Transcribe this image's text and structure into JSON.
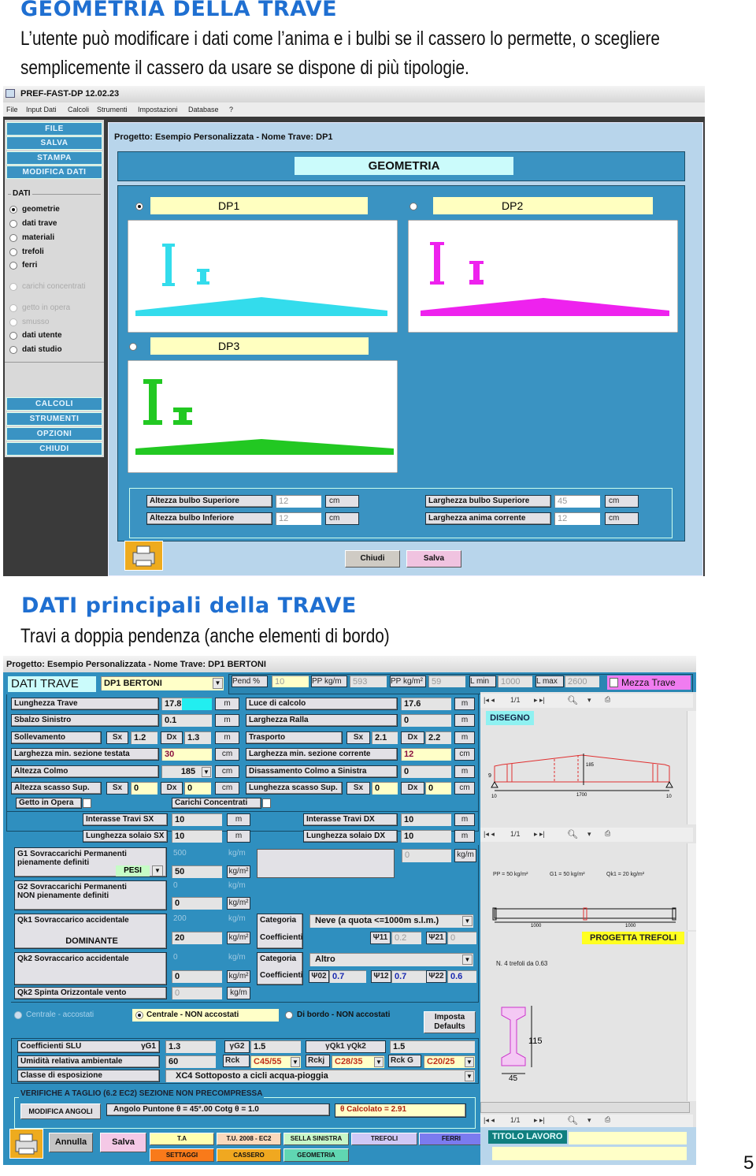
{
  "section1": {
    "heading": "GEOMETRIA DELLA TRAVE",
    "text_line1": "L’utente può modificare i dati come l’anima e i bulbi se il cassero lo permette, o scegliere",
    "text_line2": "semplicemente il cassero da usare se dispone di più tipologie."
  },
  "app1": {
    "window_title": "PREF-FAST-DP 12.02.23",
    "menu": [
      "File",
      "Input Dati",
      "Calcoli",
      "Strumenti",
      "Impostazioni",
      "Database",
      "?"
    ],
    "sidebar_top_buttons": [
      "FILE",
      "SALVA",
      "STAMPA",
      "MODIFICA DATI"
    ],
    "dati_group_label": "DATI",
    "dati_options": [
      {
        "label": "geometrie",
        "selected": true,
        "enabled": true
      },
      {
        "label": "dati trave",
        "selected": false,
        "enabled": true
      },
      {
        "label": "materiali",
        "selected": false,
        "enabled": true
      },
      {
        "label": "trefoli",
        "selected": false,
        "enabled": true
      },
      {
        "label": "ferri",
        "selected": false,
        "enabled": true
      },
      {
        "label": "carichi concentrati",
        "selected": false,
        "enabled": false
      },
      {
        "label": "getto in opera",
        "selected": false,
        "enabled": false
      },
      {
        "label": "smusso",
        "selected": false,
        "enabled": false
      },
      {
        "label": "dati utente",
        "selected": false,
        "enabled": true
      },
      {
        "label": "dati studio",
        "selected": false,
        "enabled": true
      }
    ],
    "sidebar_bottom_buttons": [
      "CALCOLI",
      "STRUMENTI",
      "OPZIONI",
      "CHIUDI"
    ],
    "project_title": "Progetto: Esempio Personalizzata - Nome Trave: DP1",
    "panel_title": "GEOMETRIA",
    "options": [
      {
        "label": "DP1",
        "selected": true,
        "color": "#33dcec"
      },
      {
        "label": "DP2",
        "selected": false,
        "color": "#ee22ee"
      },
      {
        "label": "DP3",
        "selected": false,
        "color": "#22c822"
      }
    ],
    "fields": [
      {
        "label": "Altezza bulbo Superiore",
        "value": "12",
        "unit": "cm"
      },
      {
        "label": "Altezza bulbo Inferiore",
        "value": "12",
        "unit": "cm"
      },
      {
        "label": "Larghezza bulbo Superiore",
        "value": "45",
        "unit": "cm"
      },
      {
        "label": "Larghezza anima corrente",
        "value": "12",
        "unit": "cm"
      }
    ],
    "buttons": {
      "close": "Chiudi",
      "save": "Salva"
    }
  },
  "section2": {
    "heading": "DATI principali della TRAVE",
    "text_line1": "Travi a doppia pendenza (anche elementi di bordo)"
  },
  "app2": {
    "project_title": "Progetto: Esempio Personalizzata - Nome Trave: DP1 BERTONI",
    "header": {
      "title": "DATI TRAVE",
      "trave_select": "DP1 BERTONI",
      "pend_label": "Pend %",
      "pend_value": "10",
      "pp_m_label": "PP kg/m",
      "pp_m_value": "593",
      "pp_m2_label": "PP kg/m²",
      "pp_m2_value": "59",
      "lmin_label": "L min",
      "lmin_value": "1000",
      "lmax_label": "L max",
      "lmax_value": "2600",
      "mezza_trave": "Mezza Trave",
      "mezza_trave_checked": false
    },
    "left_rows": [
      {
        "label": "Lunghezza Trave",
        "value": "17.8",
        "unit": "m"
      },
      {
        "label": "Sbalzo Sinistro",
        "value": "0.1",
        "unit": "m"
      },
      {
        "label": "Sollevamento",
        "sx_label": "Sx",
        "sx": "1.2",
        "dx_label": "Dx",
        "dx": "1.3",
        "unit": "m"
      },
      {
        "label": "Larghezza min. sezione testata",
        "value": "30",
        "unit": "cm"
      },
      {
        "label": "Altezza Colmo",
        "value": "185",
        "unit": "cm"
      },
      {
        "label": "Altezza scasso Sup.",
        "sx_label": "Sx",
        "sx": "0",
        "dx_label": "Dx",
        "dx": "0",
        "unit": "cm"
      }
    ],
    "right_rows": [
      {
        "label": "Luce di calcolo",
        "value": "17.6",
        "unit": "m"
      },
      {
        "label": "Larghezza Ralla",
        "value": "0",
        "unit": "m"
      },
      {
        "label": "Trasporto",
        "sx_label": "Sx",
        "sx": "2.1",
        "dx_label": "Dx",
        "dx": "2.2",
        "unit": "m"
      },
      {
        "label": "Larghezza min. sezione corrente",
        "value": "12",
        "unit": "cm"
      },
      {
        "label": "Disassamento Colmo a Sinistra",
        "value": "0",
        "unit": "m"
      },
      {
        "label": "Lunghezza scasso Sup.",
        "sx_label": "Sx",
        "sx": "0",
        "dx_label": "Dx",
        "dx": "0",
        "unit": "cm"
      }
    ],
    "getto_in_opera": "Getto in Opera",
    "carichi_concentrati": "Carichi Concentrati",
    "interassi": [
      {
        "label": "Interasse Travi SX",
        "value": "10",
        "unit": "m"
      },
      {
        "label": "Lunghezza solaio SX",
        "value": "10",
        "unit": "m"
      },
      {
        "label": "Interasse Travi DX",
        "value": "10",
        "unit": "m"
      },
      {
        "label": "Lunghezza solaio DX",
        "value": "10",
        "unit": "m"
      }
    ],
    "loads": {
      "g1": {
        "line1": "G1   Sovraccarichi Permanenti",
        "line2": "pienamente definiti",
        "pesi": "PESI",
        "kgm": "500",
        "kgm_unit": "kg/m",
        "value": "50",
        "unit": "kg/m²",
        "extra_value": "0",
        "extra_unit": "kg/m"
      },
      "g2": {
        "line1": "G2   Sovraccarichi Permanenti",
        "line2": "NON pienamente definiti",
        "kgm": "0",
        "kgm_unit": "kg/m",
        "value": "0",
        "unit": "kg/m²"
      },
      "qk1": {
        "line1": "Qk1  Sovraccarico accidentale",
        "line2": "DOMINANTE",
        "kgm": "200",
        "kgm_unit": "kg/m",
        "value": "20",
        "unit": "kg/m²",
        "categoria_label": "Categoria",
        "coeff_label": "Coefficienti",
        "categoria": "Neve (a quota <=1000m s.l.m.)",
        "psi11_label": "Ψ11",
        "psi11": "0.2",
        "psi21_label": "Ψ21",
        "psi21": "0"
      },
      "qk2": {
        "line1": "Qk2  Sovraccarico accidentale",
        "kgm": "0",
        "kgm_unit": "kg/m",
        "value": "0",
        "unit": "kg/m²",
        "categoria_label": "Categoria",
        "coeff_label": "Coefficienti",
        "categoria": "Altro",
        "psi02_label": "Ψ02",
        "psi02": "0.7",
        "psi12_label": "Ψ12",
        "psi12": "0.7",
        "psi22_label": "Ψ22",
        "psi22": "0.6"
      },
      "vento": {
        "label": "Qk2  Spinta Orizzontale vento",
        "value": "0",
        "unit": "kg/m"
      }
    },
    "position_options": [
      {
        "label": "Centrale - accostati",
        "selected": false,
        "enabled": false
      },
      {
        "label": "Centrale - NON accostati",
        "selected": true,
        "enabled": true
      },
      {
        "label": "Di bordo - NON accostati",
        "selected": false,
        "enabled": true
      }
    ],
    "imposta_defaults": "Imposta Defaults",
    "slu": {
      "coeff_label": "Coefficienti SLU",
      "g1_label": "γG1",
      "g1": "1.3",
      "g2_label": "γG2",
      "g2": "1.5",
      "qk_label": "γQk1  γQk2",
      "qk": "1.5",
      "umidita_label": "Umidità relativa ambientale",
      "umidita": "60",
      "rck_label": "Rck",
      "rck": "C45/55",
      "rckj_label": "Rckj",
      "rckj": "C28/35",
      "rckg_label": "Rck G",
      "rckg": "C20/25",
      "classe_label": "Classe di esposizione",
      "classe": "XC4   Sottoposto a cicli acqua-pioggia"
    },
    "verifiche": {
      "title": "VERIFICHE A TAGLIO (6.2 EC2) SEZIONE NON PRECOMPRESSA",
      "modifica": "MODIFICA ANGOLI",
      "angolo": "Angolo Puntone  θ  =  45°.00       Cotg θ  = 1.0",
      "calcolato": "θ  Calcolato =  2.91"
    },
    "bottom_buttons": [
      {
        "label": "Annulla",
        "color": "#c4c4c4"
      },
      {
        "label": "Salva",
        "color": "#f4c8e6"
      },
      {
        "label": "T.A",
        "color": "#ffffb0"
      },
      {
        "label": "T.U. 2008 - EC2",
        "color": "#fbd9bc"
      },
      {
        "label": "SELLA SINISTRA",
        "color": "#c8f6c8"
      },
      {
        "label": "TREFOLI",
        "color": "#d0c8f6"
      },
      {
        "label": "FERRI",
        "color": "#7b7bef"
      },
      {
        "label": "SETTAGGI",
        "color": "#f97a1a"
      },
      {
        "label": "CASSERO",
        "color": "#f0a820"
      },
      {
        "label": "GEOMETRIA",
        "color": "#60d6b2"
      }
    ],
    "viewer": {
      "page_counter": "1/1",
      "disegno": "DISEGNO",
      "drawing_labels": {
        "left_h": "9",
        "colmo": "185",
        "left_end": "10",
        "span": "1700",
        "right_end": "10"
      },
      "load_text": {
        "pp": "PP = 50 kg/m²",
        "g1": "G1 = 50 kg/m²",
        "qk1": "Qk1 = 20 kg/m²"
      },
      "load_dims": {
        "left": "1000",
        "right": "1000"
      },
      "progetta_trefoli": "PROGETTA TREFOLI",
      "trefoli_text": "N. 4 trefoli da 0.63",
      "section_height": "115",
      "section_width": "45",
      "titolo_lavoro": "TITOLO LAVORO",
      "titolo_value": ""
    }
  },
  "page_number": "5"
}
